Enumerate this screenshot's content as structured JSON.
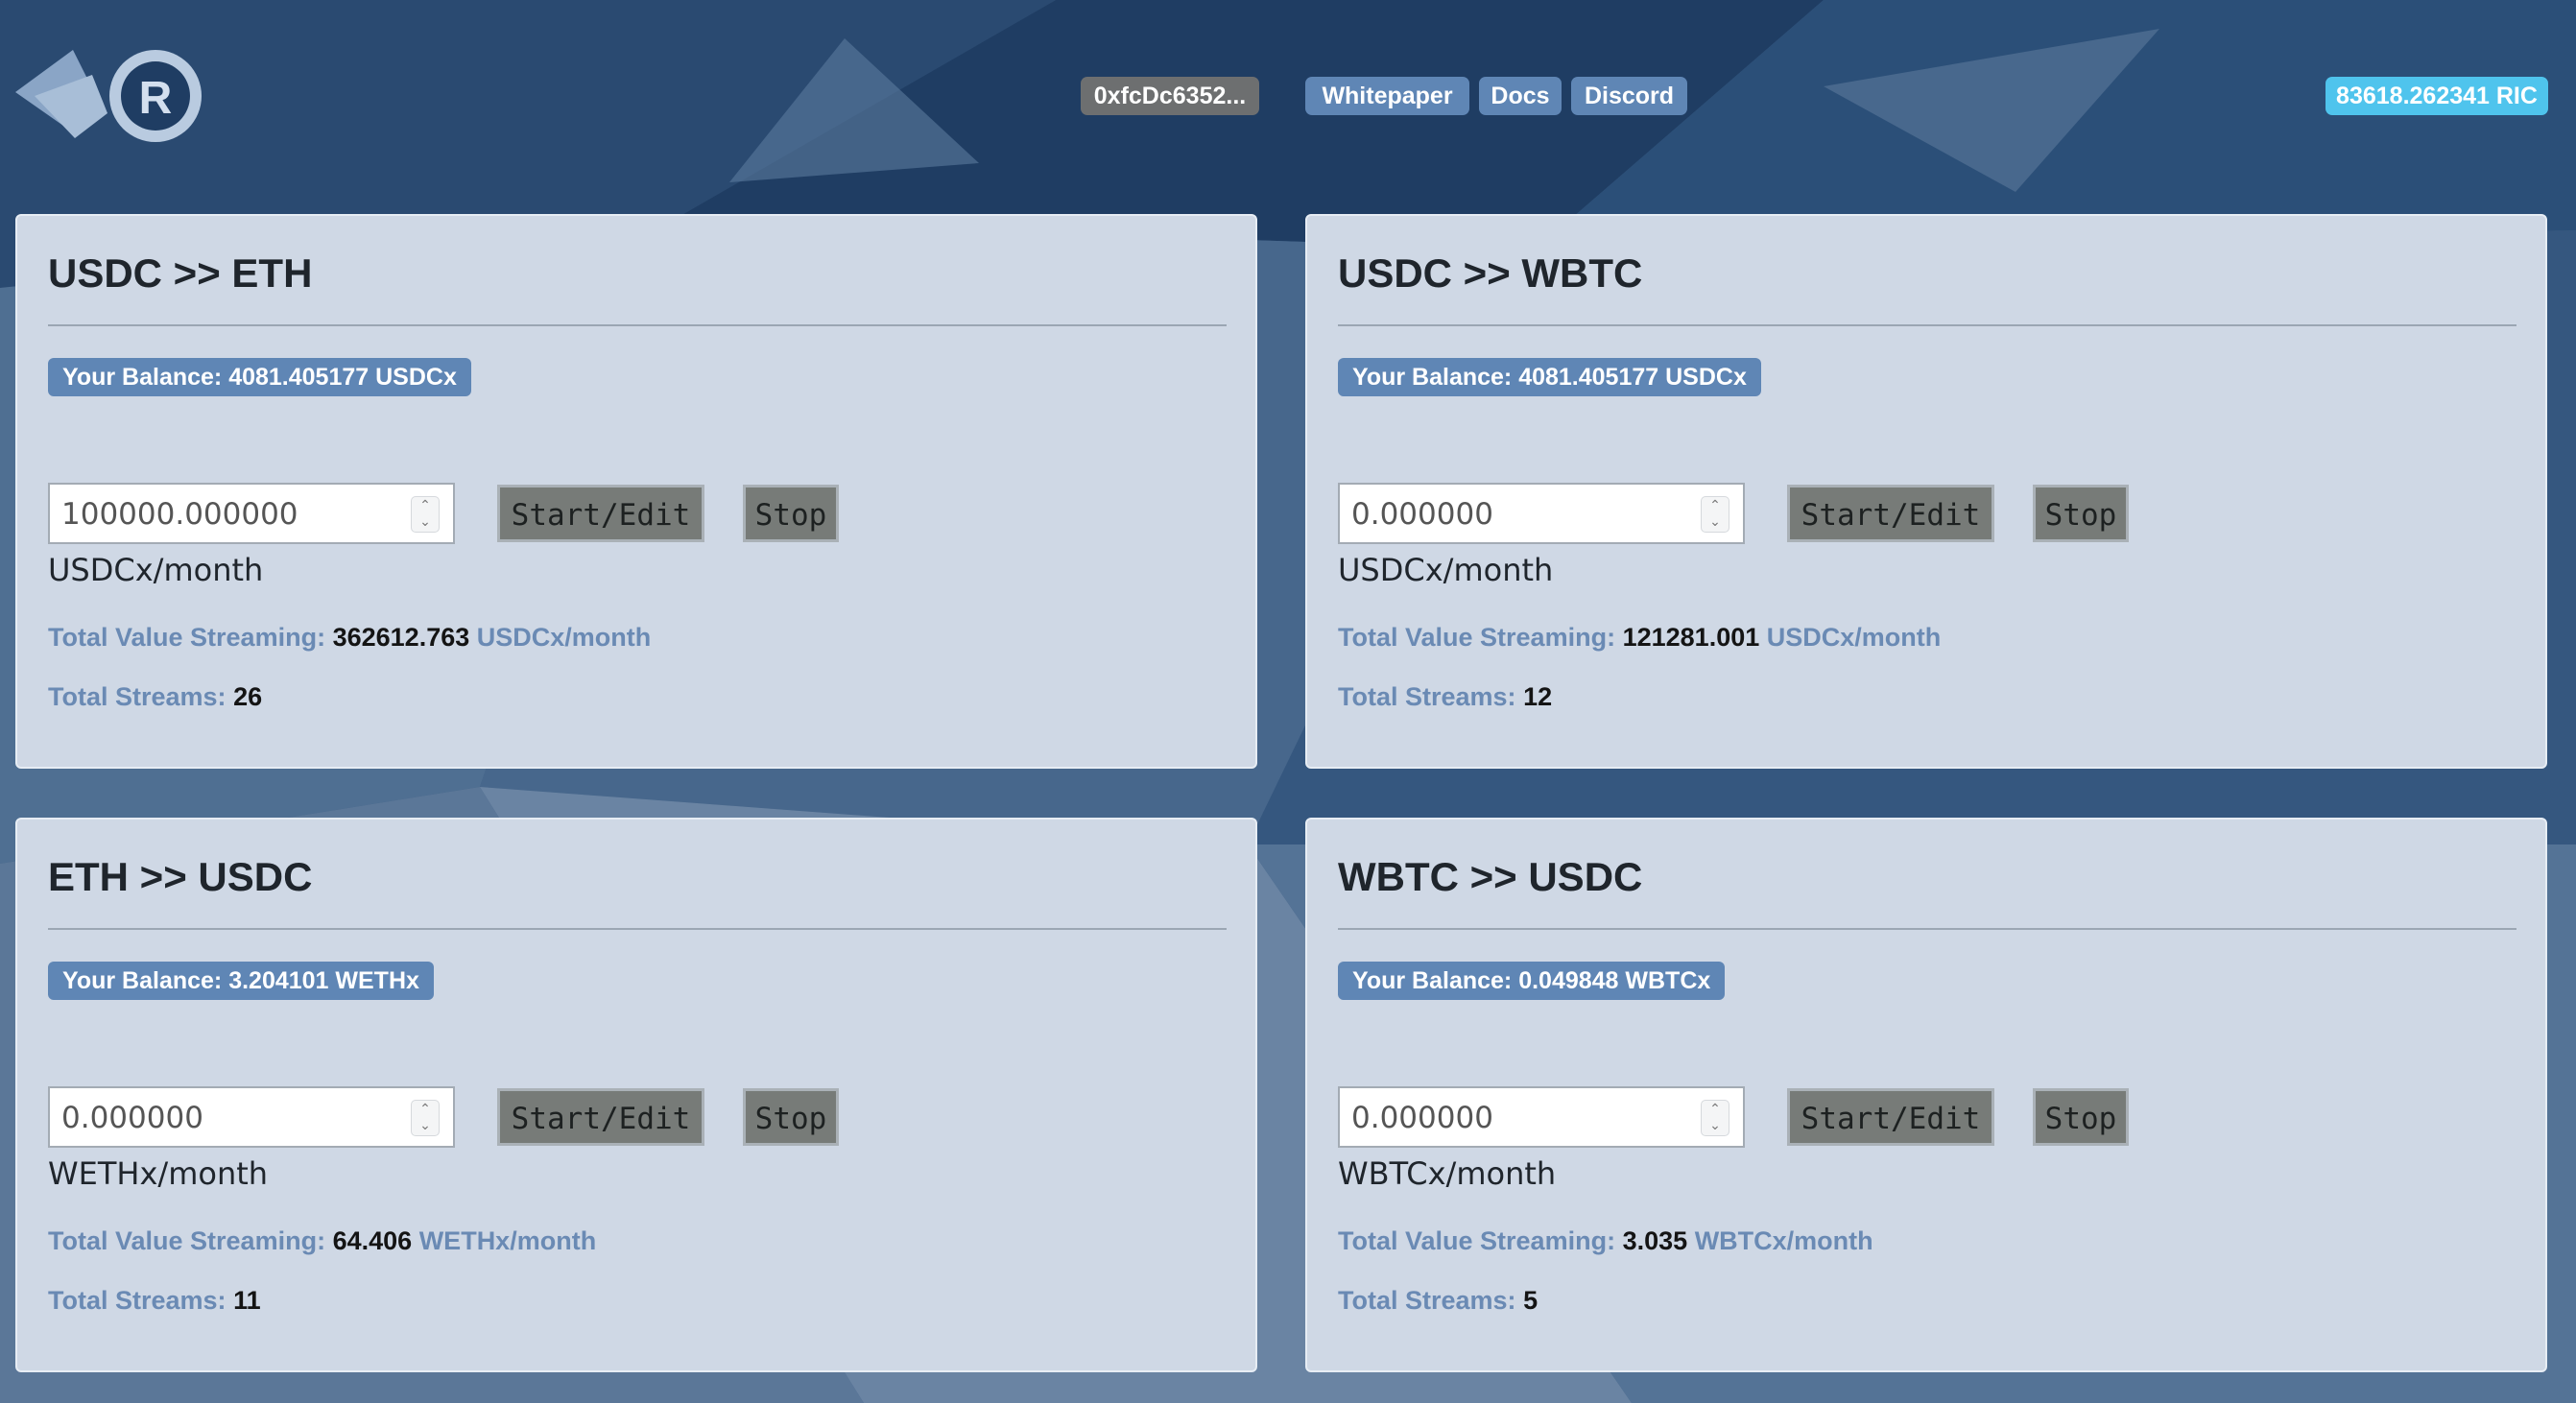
{
  "header": {
    "wallet_address": "0xfcDc6352...",
    "links": [
      "Whitepaper",
      "Docs",
      "Discord"
    ],
    "ric_balance": "83618.262341 RIC",
    "logo_icon": "ricochet-logo-icon",
    "logo_letter": "R"
  },
  "common": {
    "start_label": "Start/Edit",
    "stop_label": "Stop",
    "total_value_label": "Total Value Streaming:",
    "total_streams_label": "Total Streams:"
  },
  "markets": [
    {
      "title": "USDC >> ETH",
      "balance": "Your Balance: 4081.405177 USDCx",
      "rate_value": "100000.000000",
      "unit": "USDCx/month",
      "total_value": "362612.763",
      "total_value_unit": "USDCx/month",
      "total_streams": "26"
    },
    {
      "title": "USDC >> WBTC",
      "balance": "Your Balance: 4081.405177 USDCx",
      "rate_value": "0.000000",
      "unit": "USDCx/month",
      "total_value": "121281.001",
      "total_value_unit": "USDCx/month",
      "total_streams": "12"
    },
    {
      "title": "ETH >> USDC",
      "balance": "Your Balance: 3.204101 WETHx",
      "rate_value": "0.000000",
      "unit": "WETHx/month",
      "total_value": "64.406",
      "total_value_unit": "WETHx/month",
      "total_streams": "11"
    },
    {
      "title": "WBTC >> USDC",
      "balance": "Your Balance: 0.049848 WBTCx",
      "rate_value": "0.000000",
      "unit": "WBTCx/month",
      "total_value": "3.035",
      "total_value_unit": "WBTCx/month",
      "total_streams": "5"
    }
  ],
  "colors": {
    "background": "#3f5f82",
    "card": "#cfd8e5",
    "accent": "#5f86b5",
    "ric_badge": "#4fc4ed",
    "address_badge": "#6d6f70",
    "button": "#777b78"
  }
}
